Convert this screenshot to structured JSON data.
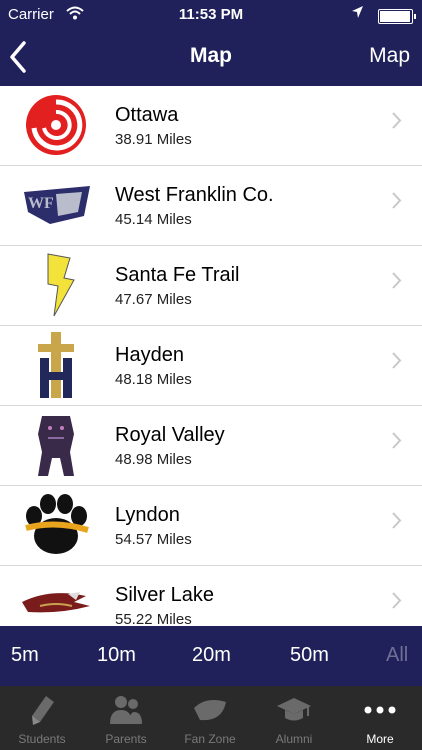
{
  "status": {
    "carrier": "Carrier",
    "time": "11:53 PM"
  },
  "nav": {
    "title": "Map",
    "right_label": "Map"
  },
  "schools": [
    {
      "name": "Ottawa",
      "distance": "38.91 Miles"
    },
    {
      "name": "West Franklin Co.",
      "distance": "45.14 Miles"
    },
    {
      "name": "Santa Fe Trail",
      "distance": "47.67 Miles"
    },
    {
      "name": "Hayden",
      "distance": "48.18 Miles"
    },
    {
      "name": "Royal Valley",
      "distance": "48.98 Miles"
    },
    {
      "name": "Lyndon",
      "distance": "54.57 Miles"
    },
    {
      "name": "Silver Lake",
      "distance": "55.22 Miles"
    }
  ],
  "filters": [
    {
      "label": "5m"
    },
    {
      "label": "10m"
    },
    {
      "label": "20m"
    },
    {
      "label": "50m"
    },
    {
      "label": "All",
      "selected": true
    }
  ],
  "tabs": [
    {
      "label": "Students",
      "icon": "pencil-icon"
    },
    {
      "label": "Parents",
      "icon": "people-icon"
    },
    {
      "label": "Fan Zone",
      "icon": "football-icon"
    },
    {
      "label": "Alumni",
      "icon": "graduation-cap-icon"
    },
    {
      "label": "More",
      "icon": "more-dots-icon",
      "active": true
    }
  ],
  "colors": {
    "navy": "#20215a",
    "tabbar": "#2a2a2a",
    "dim": "#6f7094"
  }
}
